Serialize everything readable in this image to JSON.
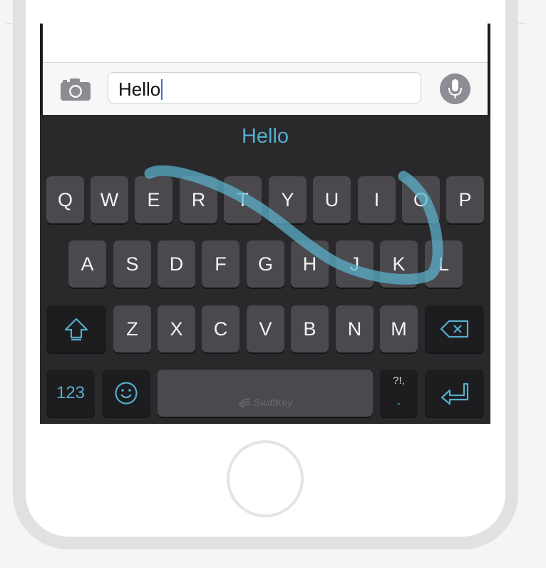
{
  "input": {
    "value": "Hello"
  },
  "prediction": {
    "text": "Hello"
  },
  "keyboard": {
    "row1": [
      "Q",
      "W",
      "E",
      "R",
      "T",
      "Y",
      "U",
      "I",
      "O",
      "P"
    ],
    "row2": [
      "A",
      "S",
      "D",
      "F",
      "G",
      "H",
      "J",
      "K",
      "L"
    ],
    "row3": [
      "Z",
      "X",
      "C",
      "V",
      "B",
      "N",
      "M"
    ],
    "numbers_label": "123",
    "punctuation_label": "?!,",
    "punctuation_dot": ".",
    "space_brand": "SwiftKey"
  },
  "colors": {
    "accent": "#55aecb",
    "keyboard_bg": "#29282b",
    "key_bg": "#4a494d"
  },
  "icons": [
    "camera-icon",
    "microphone-icon",
    "shift-icon",
    "backspace-icon",
    "emoji-icon",
    "return-icon",
    "swiftkey-logo-icon"
  ]
}
